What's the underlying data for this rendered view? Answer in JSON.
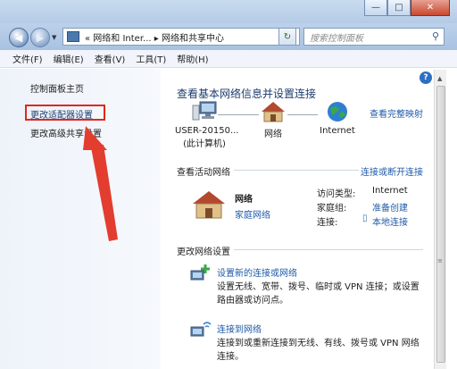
{
  "window": {
    "controls": {
      "minimize": "—",
      "maximize": "□",
      "close": "✕"
    }
  },
  "address_bar": {
    "back_glyph": "◀",
    "forward_glyph": "▶",
    "path": "« 网络和 Inter... ▸ 网络和共享中心",
    "refresh_glyph": "↻",
    "search_placeholder": "搜索控制面板",
    "search_glyph": "⚲"
  },
  "menu": [
    "文件(F)",
    "编辑(E)",
    "查看(V)",
    "工具(T)",
    "帮助(H)"
  ],
  "left_pane": {
    "links": [
      "控制面板主页",
      "更改适配器设置",
      "更改高级共享设置"
    ],
    "highlight_color": "#e0271d"
  },
  "main": {
    "help_glyph": "?",
    "title": "查看基本网络信息并设置连接",
    "full_map_link": "查看完整映射",
    "nodes": [
      {
        "label": "USER-20150...",
        "sublabel": "(此计算机)",
        "icon": "computer-icon"
      },
      {
        "label": "网络",
        "sublabel": "",
        "icon": "house-icon"
      },
      {
        "label": "Internet",
        "sublabel": "",
        "icon": "globe-icon"
      }
    ],
    "active_section": {
      "title": "查看活动网络",
      "action": "连接或断开连接",
      "network_name": "网络",
      "network_type": "家庭网络",
      "access_type_label": "访问类型:",
      "access_type_value": "Internet",
      "homegroup_label": "家庭组:",
      "homegroup_value": "准备创建",
      "connection_label": "连接:",
      "connection_value": "本地连接"
    },
    "settings_section": {
      "title": "更改网络设置",
      "tasks": [
        {
          "link": "设置新的连接或网络",
          "desc": "设置无线、宽带、拨号、临时或 VPN 连接；或设置路由器或访问点。"
        },
        {
          "link": "连接到网络",
          "desc": "连接到或重新连接到无线、有线、拨号或 VPN 网络连接。"
        }
      ]
    }
  }
}
